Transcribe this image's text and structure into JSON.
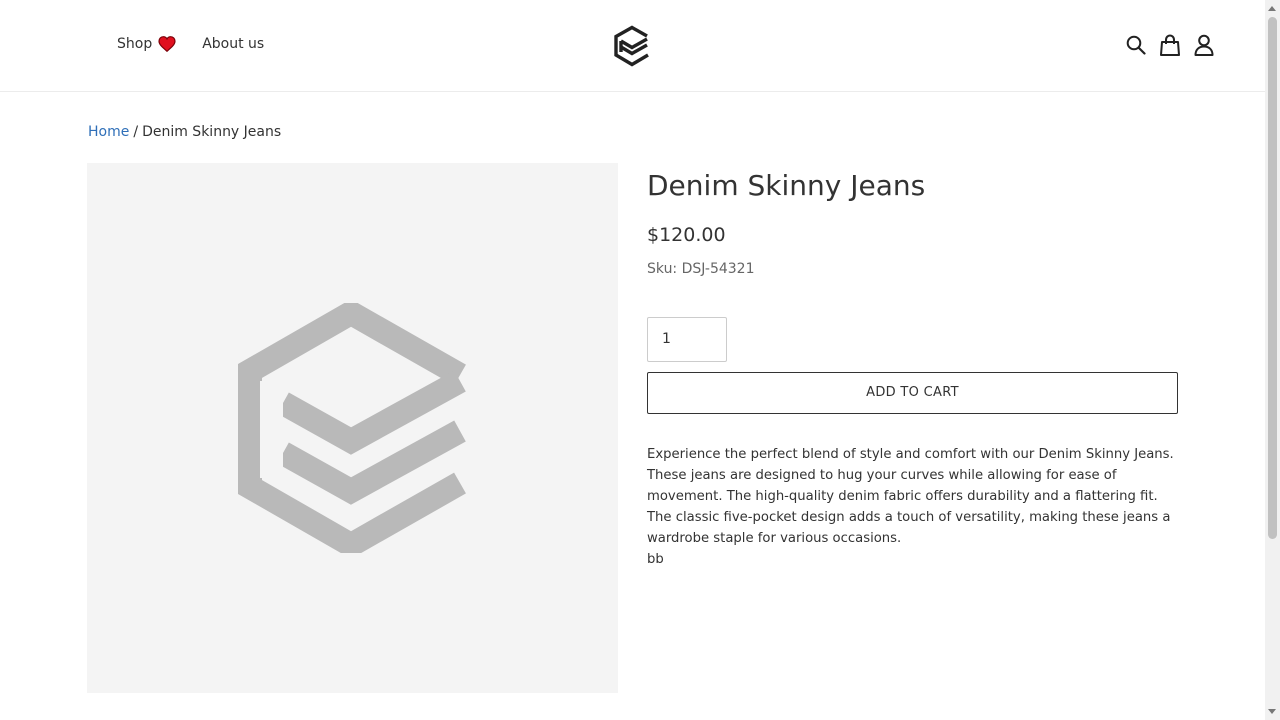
{
  "header": {
    "nav": [
      {
        "label": "Shop",
        "icon": "heart-icon"
      },
      {
        "label": "About us"
      }
    ],
    "logo_icon": "stacked-layers-logo",
    "icons": [
      "search-icon",
      "shopping-bag-icon",
      "user-icon"
    ]
  },
  "breadcrumb": {
    "home": "Home",
    "separator": "/",
    "current": "Denim Skinny Jeans"
  },
  "product": {
    "title": "Denim Skinny Jeans",
    "price": "$120.00",
    "sku": "Sku: DSJ-54321",
    "quantity": "1",
    "add_to_cart": "ADD TO CART",
    "description": "Experience the perfect blend of style and comfort with our Denim Skinny Jeans. These jeans are designed to hug your curves while allowing for ease of movement. The high-quality denim fabric offers durability and a flattering fit. The classic five-pocket design adds a touch of versatility, making these jeans a wardrobe staple for various occasions.",
    "description_extra": "bb",
    "image_placeholder_icon": "stacked-layers-logo"
  },
  "colors": {
    "accent_link": "#2f6fb8",
    "heart": "#e0101f",
    "image_bg": "#f4f4f4",
    "placeholder_logo": "#b9b9b9"
  }
}
